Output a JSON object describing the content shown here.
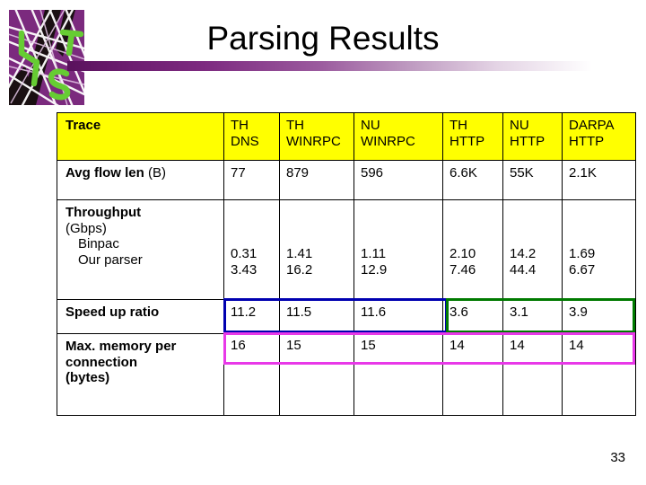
{
  "slide": {
    "title": "Parsing Results",
    "page_number": "33",
    "logo_alt": "LTS-icon"
  },
  "colors": {
    "header_fill": "#ffff00",
    "title_bar_start": "#59115c",
    "highlight_blue": "#0000b0",
    "highlight_green": "#007a00",
    "highlight_magenta": "#e838e8",
    "logo_purple": "#7b2a7e",
    "logo_green": "#66cc33"
  },
  "table": {
    "columns": [
      {
        "line1": "Trace",
        "line2": ""
      },
      {
        "line1": "TH",
        "line2": "DNS"
      },
      {
        "line1": "TH",
        "line2": "WINRPC"
      },
      {
        "line1": "NU",
        "line2": "WINRPC"
      },
      {
        "line1": "TH",
        "line2": "HTTP"
      },
      {
        "line1": "NU",
        "line2": "HTTP"
      },
      {
        "line1": "DARPA",
        "line2": "HTTP"
      }
    ],
    "rows": {
      "avg_flow": {
        "label_bold": "Avg flow len",
        "label_rest": " (B)",
        "values": [
          "77",
          "879",
          "596",
          "6.6K",
          "55K",
          "2.1K"
        ]
      },
      "throughput": {
        "label_bold": "Throughput",
        "label_unit": "(Gbps)",
        "sub_1": "Binpac",
        "sub_2": "Our parser",
        "binpac": [
          "0.31",
          "1.41",
          "1.11",
          "2.10",
          "14.2",
          "1.69"
        ],
        "our_parser": [
          "3.43",
          "16.2",
          "12.9",
          "7.46",
          "44.4",
          "6.67"
        ]
      },
      "speed_up": {
        "label_bold": "Speed up ratio",
        "values": [
          "11.2",
          "11.5",
          "11.6",
          "3.6",
          "3.1",
          "3.9"
        ]
      },
      "max_memory": {
        "label_line1": "Max. memory per",
        "label_line2": "connection",
        "label_line3": "(bytes)",
        "values": [
          "16",
          "15",
          "15",
          "14",
          "14",
          "14"
        ]
      }
    }
  }
}
